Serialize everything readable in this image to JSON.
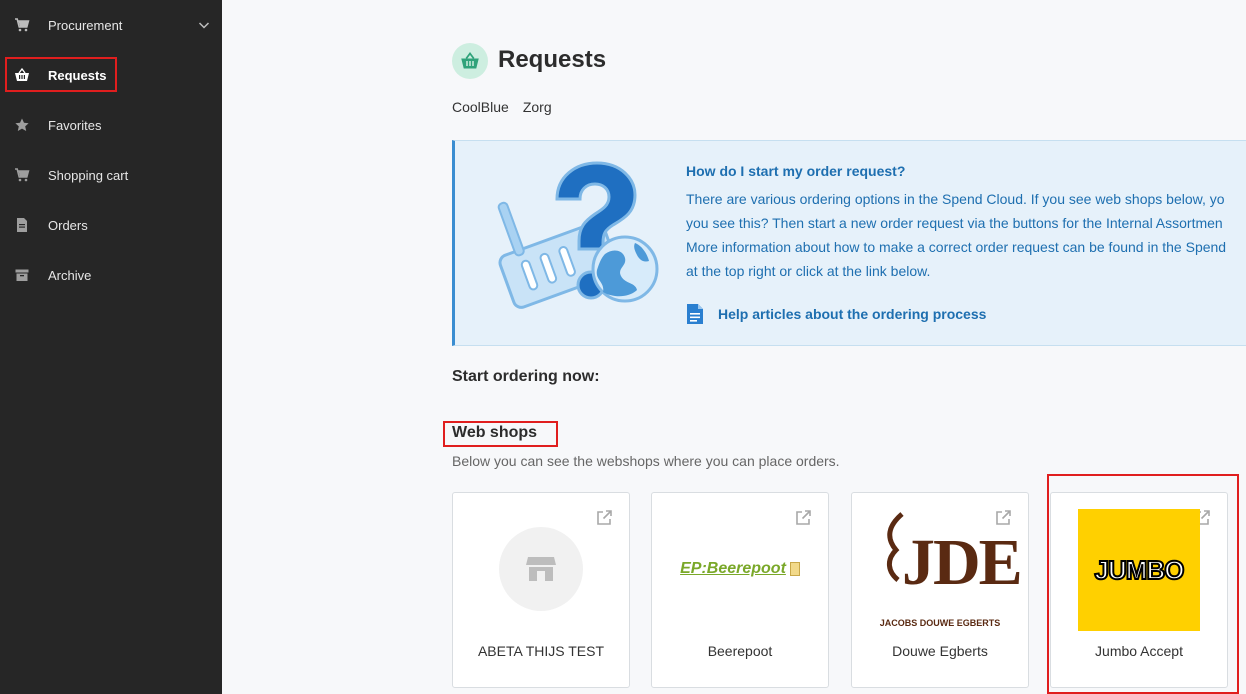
{
  "sidebar": {
    "items": [
      {
        "label": "Procurement",
        "icon": "cart-icon"
      },
      {
        "label": "Requests",
        "icon": "basket-icon"
      },
      {
        "label": "Favorites",
        "icon": "star-icon"
      },
      {
        "label": "Shopping cart",
        "icon": "cart-icon"
      },
      {
        "label": "Orders",
        "icon": "document-icon"
      },
      {
        "label": "Archive",
        "icon": "archive-icon"
      }
    ]
  },
  "header": {
    "title": "Requests",
    "breadcrumb": [
      "CoolBlue",
      "Zorg"
    ]
  },
  "info": {
    "title": "How do I start my order request?",
    "lines": [
      "There are various ordering options in the Spend Cloud. If you see web shops below, yo",
      "you see this? Then start a new order request via the buttons for the Internal Assortmen",
      "More information about how to make a correct order request can be found in the Spend",
      "at the top right or click at the link below."
    ],
    "link": "Help articles about the ordering process"
  },
  "start_ordering": "Start ordering now:",
  "webshops": {
    "title": "Web shops",
    "subtitle": "Below you can see the webshops where you can place orders.",
    "cards": [
      {
        "label": "ABETA THIJS TEST"
      },
      {
        "label": "Beerepoot",
        "logo_text": "EP:Beerepoot"
      },
      {
        "label": "Douwe Egberts",
        "logo_text": "JDE",
        "logo_sub": "JACOBS DOUWE EGBERTS"
      },
      {
        "label": "Jumbo Accept",
        "logo_text": "JUMBO"
      }
    ]
  },
  "colors": {
    "sidebar_bg": "#262626",
    "accent_blue": "#1e6fb0",
    "highlight_red": "#e01e1e",
    "jumbo_yellow": "#ffd000",
    "header_icon_bg": "#cdeee0",
    "header_icon_fg": "#2fa37a"
  }
}
